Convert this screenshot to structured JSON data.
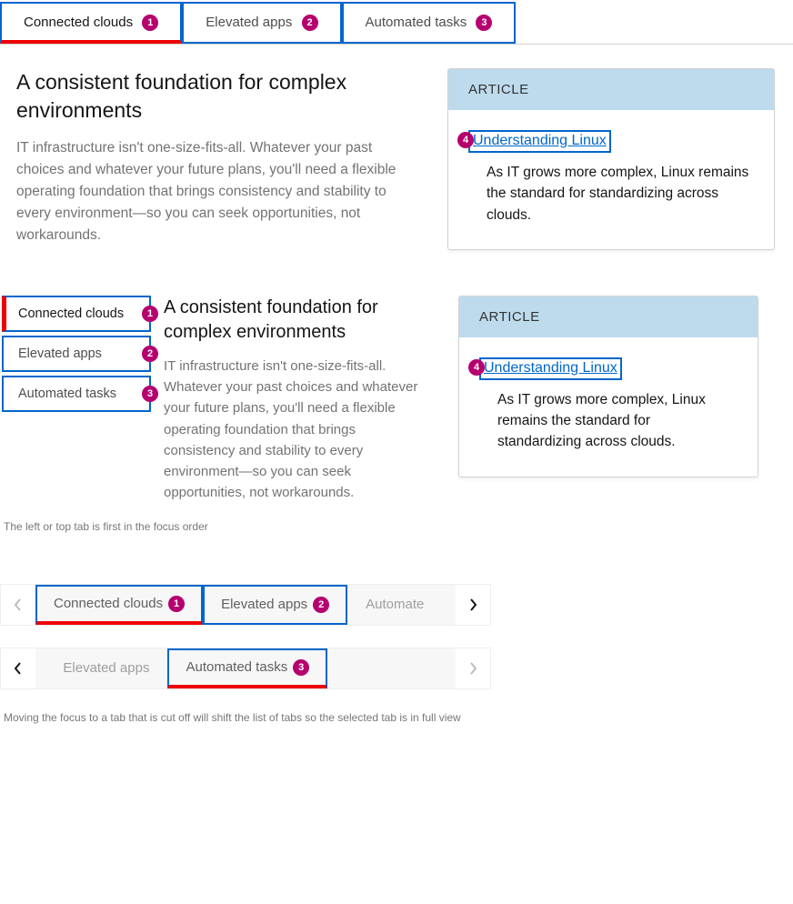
{
  "tabs": {
    "t1": "Connected clouds",
    "t2": "Elevated apps",
    "t3": "Automated tasks"
  },
  "badges": {
    "n1": "1",
    "n2": "2",
    "n3": "3",
    "n4": "4"
  },
  "content": {
    "heading": "A consistent foundation for complex environments",
    "body": "IT infrastructure isn't one-size-fits-all. Whatever your past choices and whatever your future plans, you'll need a flexible operating foundation that brings consistency and stability to every environment—so you can seek opportunities, not workarounds."
  },
  "card": {
    "eyebrow": "ARTICLE",
    "link": "Understanding Linux",
    "text": "As IT grows more complex, Linux remains the standard for standardizing across clouds."
  },
  "captions": {
    "c1": "The left or top tab is first in the focus order",
    "c2": "Moving the focus to a tab that is cut off will shift the list of tabs so the selected tab is in full view"
  },
  "overflow": {
    "partial_left": "ted clouds",
    "partial_right": "Automate"
  }
}
